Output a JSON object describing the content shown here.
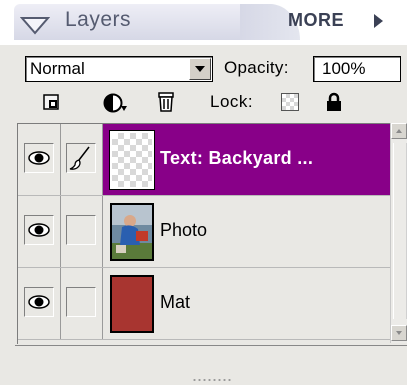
{
  "panel": {
    "title": "Layers",
    "more_label": "MORE",
    "icons": {
      "collapse": "triangle-down-icon",
      "more": "triangle-right-icon"
    }
  },
  "blend": {
    "mode": "Normal",
    "opacity_label": "Opacity:",
    "opacity_value": "100%"
  },
  "tools": {
    "lock_label": "Lock:",
    "items": [
      "new-layer-icon",
      "adjustment-layer-icon",
      "trash-icon",
      "lock-transparency-icon",
      "lock-all-icon"
    ]
  },
  "layers": [
    {
      "name": "Text: Backyard ...",
      "visible": true,
      "linked_brush": true,
      "selected": true,
      "thumb": "transparent"
    },
    {
      "name": "Photo",
      "visible": true,
      "linked_brush": false,
      "selected": false,
      "thumb": "photo"
    },
    {
      "name": "Mat",
      "visible": true,
      "linked_brush": false,
      "selected": false,
      "thumb": "solid",
      "thumb_color": "#a83530"
    }
  ],
  "colors": {
    "selection": "#880088",
    "panel_bg": "#e9e8e4",
    "mat": "#a83530"
  }
}
